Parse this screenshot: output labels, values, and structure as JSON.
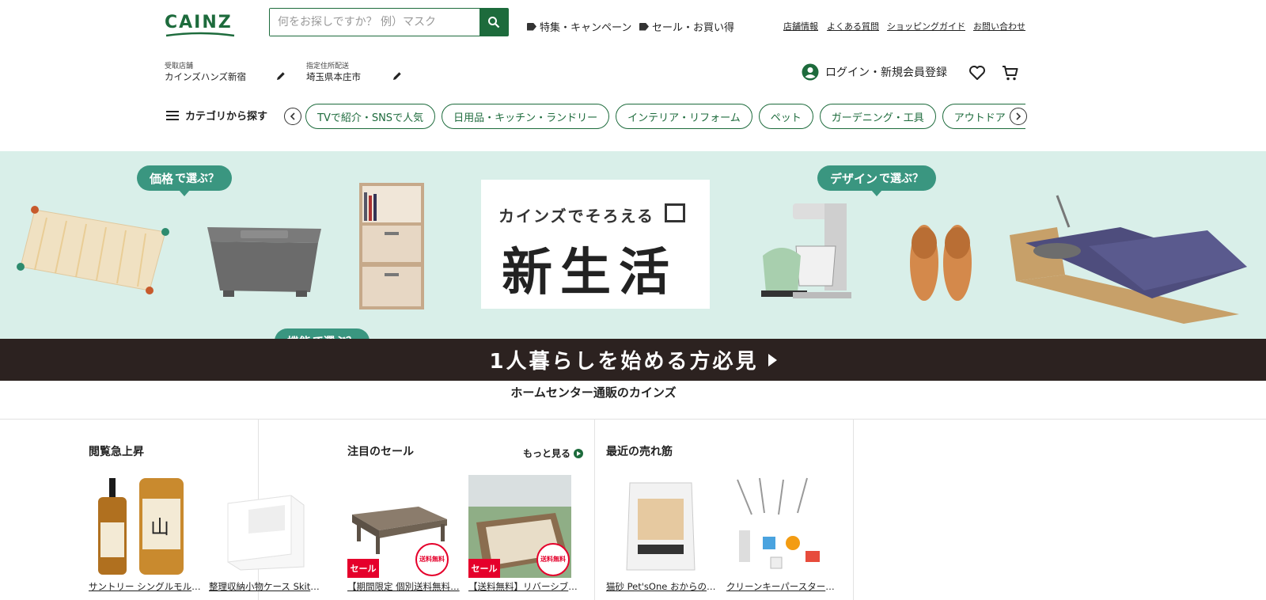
{
  "header": {
    "logo": "CAINZ",
    "search_placeholder": "何をお探しですか？ 例）マスク",
    "campaign_link": "特集・キャンペーン",
    "sale_link": "セール・お買い得",
    "util_links": [
      "店舗情報",
      "よくある質問",
      "ショッピングガイド",
      "お問い合わせ"
    ]
  },
  "store": {
    "pickup_label": "受取店舗",
    "pickup_value": "カインズハンズ新宿",
    "delivery_label": "指定住所配送",
    "delivery_value": "埼玉県本庄市"
  },
  "account": {
    "login_label": "ログイン・新規会員登録"
  },
  "category_nav": {
    "menu_label": "カテゴリから探す",
    "pills": [
      "TVで紹介・SNSで人気",
      "日用品・キッチン・ランドリー",
      "インテリア・リフォーム",
      "ペット",
      "ガーデニング・工具",
      "アウトドア・エ"
    ]
  },
  "banner": {
    "bubble_price": "価格",
    "bubble_function": "機能",
    "bubble_design": "デザイン",
    "bubble_suffix": "で選ぶ？",
    "card_sub": "カインズでそろえる",
    "card_main": "新生活",
    "bar_text": "1人暮らしを始める方必見"
  },
  "tagline": "ホームセンター通販のカインズ",
  "sections": [
    {
      "title": "閲覧急上昇",
      "products": [
        {
          "name": "サントリー シングルモルト…"
        },
        {
          "name": "整理収納小物ケース Skitto…"
        }
      ]
    },
    {
      "title": "注目のセール",
      "more_label": "もっと見る",
      "products": [
        {
          "name": "【期間限定 個別送料無料…",
          "badge": "セール",
          "ship": "送料無料"
        },
        {
          "name": "【送料無料】リバーシブル…",
          "badge": "セール",
          "ship": "送料無料"
        }
      ]
    },
    {
      "title": "最近の売れ筋",
      "products": [
        {
          "name": "猫砂 Pet'sOne おからのネ…"
        },
        {
          "name": "クリーンキーパースタート…"
        }
      ]
    }
  ],
  "colors": {
    "brand_green": "#1d6b3c",
    "banner_bg": "#d9efe9",
    "bubble": "#3a9680",
    "sale_red": "#e5002b"
  }
}
